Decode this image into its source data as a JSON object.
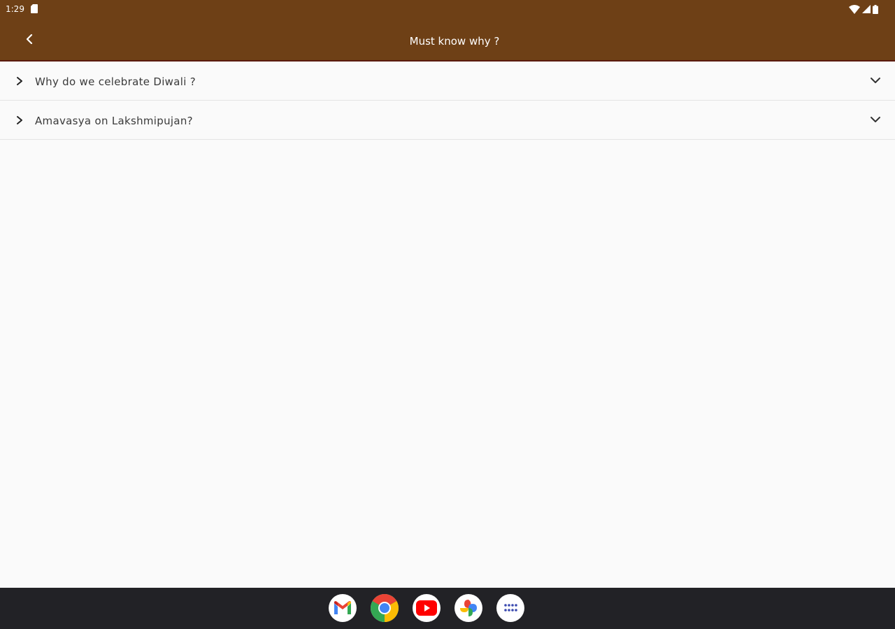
{
  "status_bar": {
    "time": "1:29",
    "icons": [
      "sd-card-icon",
      "wifi-icon",
      "signal-icon",
      "battery-icon"
    ]
  },
  "app_bar": {
    "title": "Must know why ?",
    "back_icon": "back-arrow-icon",
    "background_color": "#6e4016",
    "border_color": "#5a1a0e"
  },
  "faq": {
    "items": [
      {
        "question": "Why do we celebrate Diwali ?"
      },
      {
        "question": "Amavasya on Lakshmipujan?"
      }
    ]
  },
  "dock": {
    "apps": [
      "gmail-icon",
      "chrome-icon",
      "youtube-icon",
      "photos-icon",
      "app-drawer-icon"
    ],
    "background_color": "#222226"
  }
}
